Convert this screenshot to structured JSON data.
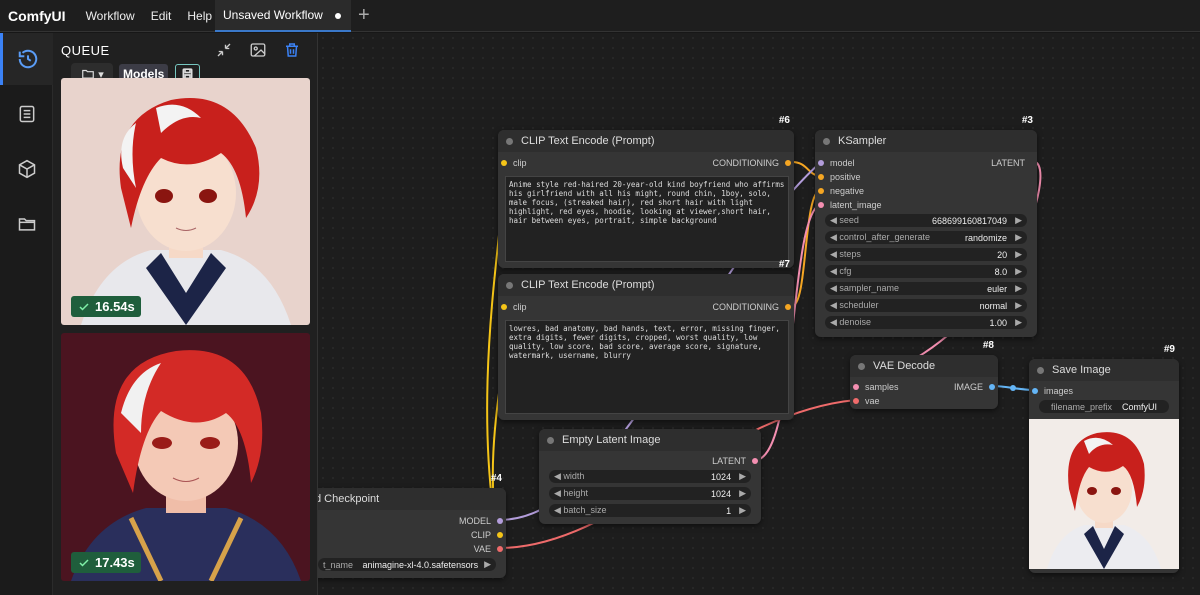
{
  "app": {
    "brand": "ComfyUI"
  },
  "menu": [
    "Workflow",
    "Edit",
    "Help"
  ],
  "tab": {
    "label": "Unsaved Workflow"
  },
  "queue": {
    "title": "QUEUE",
    "models_tooltip": "Models",
    "items": [
      {
        "time": "16.54s"
      },
      {
        "time": "17.43s"
      }
    ]
  },
  "icons": [
    "history-icon",
    "workflow-icon",
    "model-library-icon",
    "folder-icon",
    "collapse-icon",
    "image-icon",
    "trash-icon",
    "save-icon",
    "plus-icon"
  ],
  "nodes": {
    "clip6": {
      "id": "#6",
      "title": "CLIP Text Encode (Prompt)",
      "in_clip": "clip",
      "out": "CONDITIONING",
      "text": "Anime style red-haired 20-year-old kind boyfriend who affirms his girlfriend with all his might, round chin, 1boy, solo, male focus, (streaked hair), red short hair with light highlight,  red eyes, hoodie,  looking at viewer,short hair, hair between eyes, portrait,  simple background"
    },
    "clip7": {
      "id": "#7",
      "title": "CLIP Text Encode (Prompt)",
      "in_clip": "clip",
      "out": "CONDITIONING",
      "text": "lowres, bad anatomy, bad hands, text, error, missing finger, extra digits, fewer digits, cropped, worst quality, low quality, low score, bad score, average score, signature, watermark, username, blurry"
    },
    "ksampler": {
      "id": "#3",
      "title": "KSampler",
      "inputs": [
        "model",
        "positive",
        "negative",
        "latent_image"
      ],
      "out": "LATENT",
      "widgets": [
        {
          "label": "seed",
          "value": "668699160817049"
        },
        {
          "label": "control_after_generate",
          "value": "randomize"
        },
        {
          "label": "steps",
          "value": "20"
        },
        {
          "label": "cfg",
          "value": "8.0"
        },
        {
          "label": "sampler_name",
          "value": "euler"
        },
        {
          "label": "scheduler",
          "value": "normal"
        },
        {
          "label": "denoise",
          "value": "1.00"
        }
      ]
    },
    "vae": {
      "id": "#8",
      "title": "VAE Decode",
      "inputs": [
        "samples",
        "vae"
      ],
      "out": "IMAGE"
    },
    "save": {
      "id": "#9",
      "title": "Save Image",
      "input": "images",
      "widget": {
        "label": "filename_prefix",
        "value": "ComfyUI"
      }
    },
    "latent": {
      "id": "",
      "title": "Empty Latent Image",
      "out": "LATENT",
      "widgets": [
        {
          "label": "width",
          "value": "1024"
        },
        {
          "label": "height",
          "value": "1024"
        },
        {
          "label": "batch_size",
          "value": "1"
        }
      ]
    },
    "ckpt": {
      "id": "#4",
      "title": "d Checkpoint",
      "outs": [
        "MODEL",
        "CLIP",
        "VAE"
      ],
      "widget": {
        "label": "t_name",
        "value": "animagine-xl-4.0.safetensors"
      }
    }
  },
  "colors": {
    "clip": "#f5c518",
    "conditioning": "#f5a623",
    "model": "#b39ddb",
    "latent": "#f48fb1",
    "vae": "#ef6b6b",
    "image": "#64b5f6",
    "accent": "#3b82f6"
  }
}
